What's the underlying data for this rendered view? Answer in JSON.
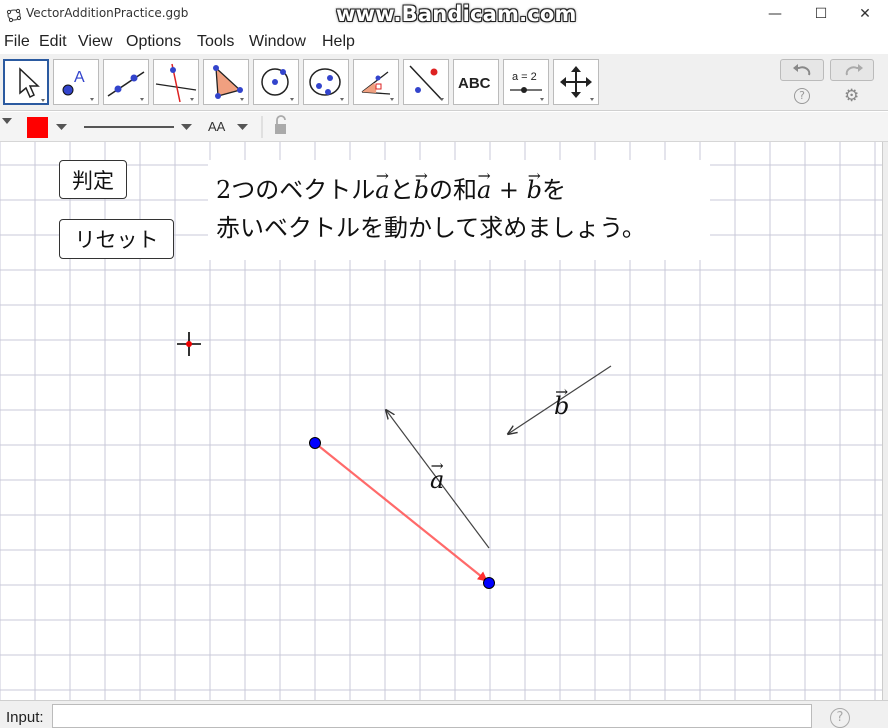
{
  "window": {
    "title": "VectorAdditionPractice.ggb",
    "watermark": "www.Bandicam.com",
    "minimize": "—",
    "maximize": "☐",
    "close": "✕"
  },
  "menu": {
    "items": [
      "File",
      "Edit",
      "View",
      "Options",
      "Tools",
      "Window",
      "Help"
    ]
  },
  "toolbar": {
    "tools": [
      {
        "name": "move-tool"
      },
      {
        "name": "point-tool"
      },
      {
        "name": "line-tool"
      },
      {
        "name": "perpendicular-line-tool"
      },
      {
        "name": "polygon-tool"
      },
      {
        "name": "circle-center-tool"
      },
      {
        "name": "ellipse-tool"
      },
      {
        "name": "angle-tool"
      },
      {
        "name": "reflect-tool"
      },
      {
        "name": "text-tool",
        "label": "ABC"
      },
      {
        "name": "slider-tool",
        "label": "a = 2"
      },
      {
        "name": "move-graphics-view-tool"
      }
    ],
    "help_label": "?",
    "settings_label": "⚙"
  },
  "stylebar": {
    "color": "#ff0000",
    "font_size_label": "AA"
  },
  "canvas": {
    "judge_button": "判定",
    "reset_button": "リセット",
    "instruction_line1_prefix": "2つのベクトル",
    "instruction_line1_a": "a",
    "instruction_line1_and": "と",
    "instruction_line1_b": "b",
    "instruction_line1_sum": "の和",
    "instruction_line1_a2": "a",
    "instruction_line1_plus": " + ",
    "instruction_line1_b2": "b",
    "instruction_line1_suffix": "を",
    "instruction_line2": "赤いベクトルを動かして求めましょう。",
    "vector_a_label": "a",
    "vector_b_label": "b",
    "accent_red": "#ff0000",
    "point_blue": "#0000ff"
  },
  "input_bar": {
    "label": "Input:",
    "value": "",
    "help": "?"
  }
}
